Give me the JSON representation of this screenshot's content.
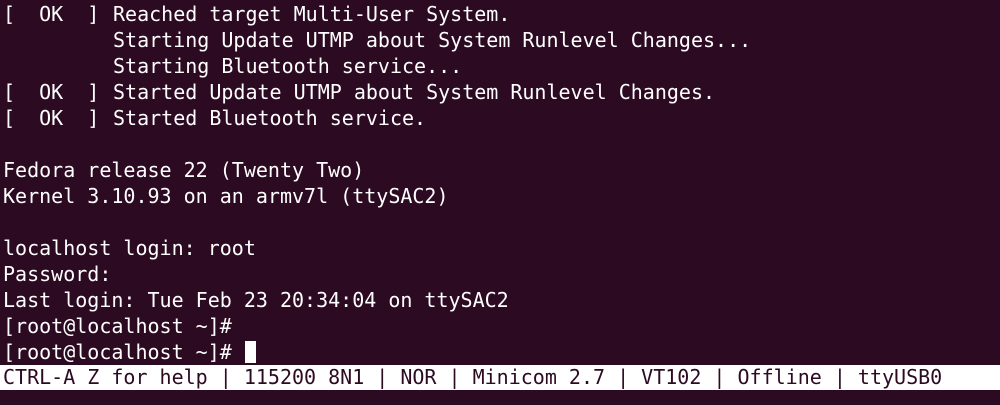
{
  "terminal": {
    "boot_lines": [
      {
        "status": "OK",
        "text": "Reached target Multi-User System."
      },
      {
        "status": "",
        "text": "Starting Update UTMP about System Runlevel Changes..."
      },
      {
        "status": "",
        "text": "Starting Bluetooth service..."
      },
      {
        "status": "OK",
        "text": "Started Update UTMP about System Runlevel Changes."
      },
      {
        "status": "OK",
        "text": "Started Bluetooth service."
      }
    ],
    "release": "Fedora release 22 (Twenty Two)",
    "kernel": "Kernel 3.10.93 on an armv7l (ttySAC2)",
    "login_prompt": "localhost login: root",
    "password_prompt": "Password:",
    "last_login": "Last login: Tue Feb 23 20:34:04 on ttySAC2",
    "prompts": [
      "[root@localhost ~]#",
      "[root@localhost ~]#"
    ]
  },
  "statusbar": {
    "text": "CTRL-A Z for help | 115200 8N1 | NOR | Minicom 2.7 | VT102 | Offline | ttyUSB0"
  },
  "colors": {
    "background": "#2c0a22",
    "foreground": "#ffffff"
  }
}
